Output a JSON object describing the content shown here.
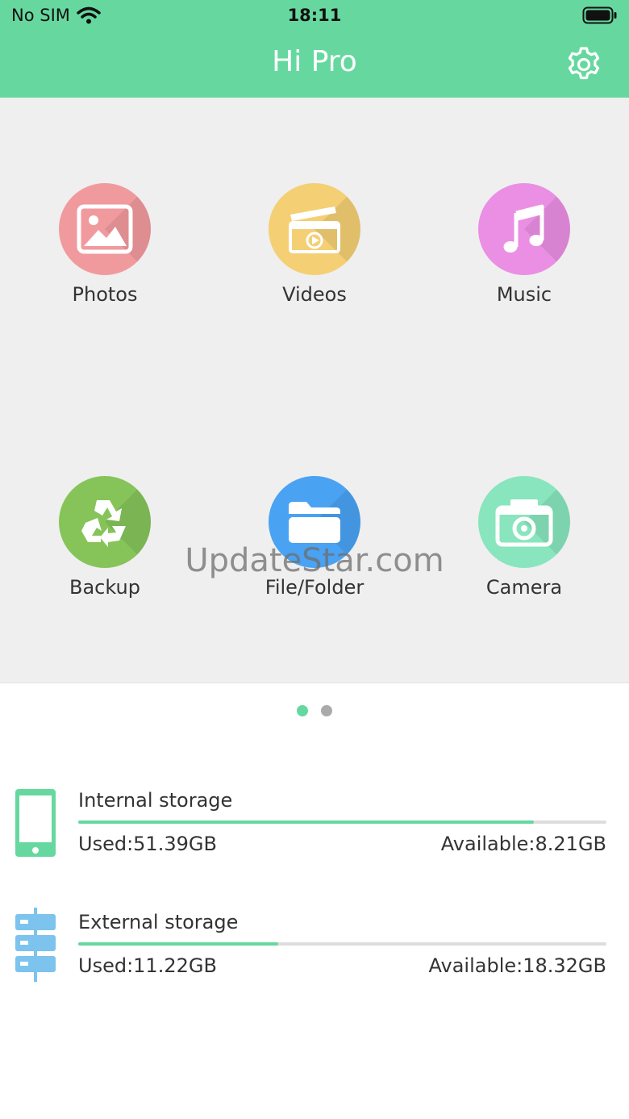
{
  "status": {
    "carrier": "No SIM",
    "time": "18:11"
  },
  "header": {
    "title": "Hi Pro"
  },
  "grid": [
    {
      "label": "Photos",
      "icon": "photo-icon",
      "color": "#f19a9e"
    },
    {
      "label": "Videos",
      "icon": "clapperboard-icon",
      "color": "#f4cf74"
    },
    {
      "label": "Music",
      "icon": "music-note-icon",
      "color": "#ea8fe4"
    },
    {
      "label": "Backup",
      "icon": "recycle-icon",
      "color": "#86c45a"
    },
    {
      "label": "File/Folder",
      "icon": "folder-icon",
      "color": "#4aa2f2"
    },
    {
      "label": "Camera",
      "icon": "camera-icon",
      "color": "#88e5bd"
    }
  ],
  "watermark": "UpdateStar.com",
  "pager": {
    "total": 2,
    "active": 1,
    "active_color": "#66d89f",
    "inactive_color": "#aaaaaa"
  },
  "storage": {
    "internal": {
      "title": "Internal storage",
      "used": "Used:51.39GB",
      "available": "Available:8.21GB",
      "fill_fraction": 0.862
    },
    "external": {
      "title": "External storage",
      "used": "Used:11.22GB",
      "available": "Available:18.32GB",
      "fill_fraction": 0.378
    }
  },
  "colors": {
    "accent": "#66d89f",
    "external_icon": "#7cc3ee"
  }
}
